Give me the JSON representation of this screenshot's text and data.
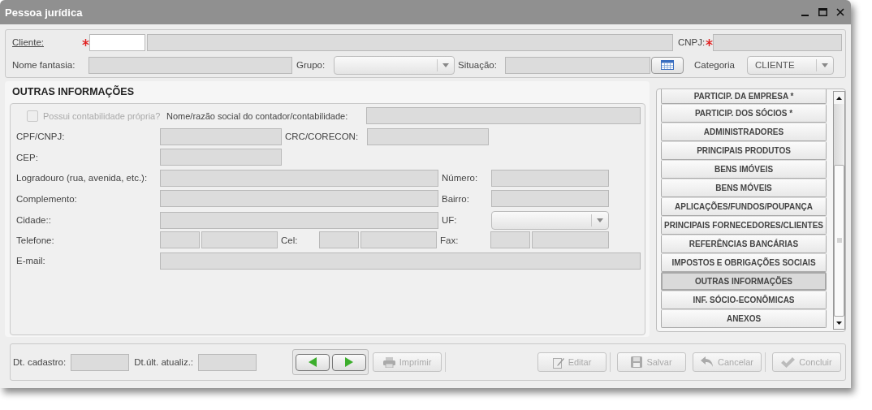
{
  "window": {
    "title": "Pessoa jurídica"
  },
  "header": {
    "cliente": {
      "label": "Cliente:",
      "required": true,
      "code_disabled": false,
      "name_disabled": true
    },
    "cnpj": {
      "label": "CNPJ:",
      "required": true,
      "disabled": true
    },
    "nome_fantasia": {
      "label": "Nome fantasia:",
      "disabled": true
    },
    "grupo": {
      "label": "Grupo:"
    },
    "situacao": {
      "label": "Situação:",
      "disabled": true
    },
    "categoria": {
      "label": "Categoria",
      "value": "CLIENTE"
    }
  },
  "section": {
    "title": "OUTRAS INFORMAÇÕES",
    "rows": [
      [
        {
          "kind": "checkbox",
          "label": "Possui contabilidade própria?",
          "checked": false,
          "disabled": true
        },
        {
          "kind": "label",
          "text": "Nome/razão social do contador/contabilidade:"
        },
        {
          "kind": "field",
          "disabled": true
        }
      ],
      [
        {
          "kind": "label",
          "text": "CPF/CNPJ:"
        },
        {
          "kind": "field",
          "disabled": true
        },
        {
          "kind": "label",
          "text": "CRC/CORECON:"
        },
        {
          "kind": "field",
          "disabled": true
        }
      ],
      [
        {
          "kind": "label",
          "text": "CEP:"
        },
        {
          "kind": "field",
          "disabled": true
        }
      ],
      [
        {
          "kind": "label",
          "text": "Logradouro (rua, avenida, etc.):"
        },
        {
          "kind": "field",
          "disabled": true
        },
        {
          "kind": "label",
          "text": "Número:"
        },
        {
          "kind": "field",
          "disabled": true
        }
      ],
      [
        {
          "kind": "label",
          "text": "Complemento:"
        },
        {
          "kind": "field",
          "disabled": true
        },
        {
          "kind": "label",
          "text": "Bairro:"
        },
        {
          "kind": "field",
          "disabled": true
        }
      ],
      [
        {
          "kind": "label",
          "text": "Cidade::"
        },
        {
          "kind": "field",
          "disabled": true
        },
        {
          "kind": "label",
          "text": "UF:"
        },
        {
          "kind": "select"
        }
      ],
      [
        {
          "kind": "label",
          "text": "Telefone:"
        },
        {
          "kind": "phone",
          "disabled": true
        },
        {
          "kind": "label",
          "text": "Cel:"
        },
        {
          "kind": "phone",
          "disabled": true
        },
        {
          "kind": "label",
          "text": "Fax:"
        },
        {
          "kind": "phone",
          "disabled": true
        }
      ],
      [
        {
          "kind": "label",
          "text": "E-mail:"
        },
        {
          "kind": "field",
          "disabled": true
        }
      ]
    ]
  },
  "side_list": [
    {
      "label": "PARTICIP. DA EMPRESA *",
      "selected": false
    },
    {
      "label": "PARTICIP. DOS SÓCIOS *",
      "selected": false
    },
    {
      "label": "ADMINISTRADORES",
      "selected": false
    },
    {
      "label": "PRINCIPAIS PRODUTOS",
      "selected": false
    },
    {
      "label": "BENS IMÓVEIS",
      "selected": false
    },
    {
      "label": "BENS MÓVEIS",
      "selected": false
    },
    {
      "label": "APLICAÇÕES/FUNDOS/POUPANÇA",
      "selected": false
    },
    {
      "label": "PRINCIPAIS FORNECEDORES/CLIENTES",
      "selected": false
    },
    {
      "label": "REFERÊNCIAS BANCÁRIAS",
      "selected": false
    },
    {
      "label": "IMPOSTOS E OBRIGAÇÕES SOCIAIS",
      "selected": false
    },
    {
      "label": "OUTRAS INFORMAÇÕES",
      "selected": true
    },
    {
      "label": "INF. SÓCIO-ECONÔMICAS",
      "selected": false
    },
    {
      "label": "ANEXOS",
      "selected": false
    }
  ],
  "footer": {
    "dt_cadastro": {
      "label": "Dt. cadastro:",
      "disabled": true
    },
    "dt_atualiz": {
      "label": "Dt.últ. atualiz.:",
      "disabled": true
    },
    "print_button": {
      "label": "Imprimir",
      "disabled": true
    },
    "actions": [
      {
        "label": "Editar",
        "disabled": true
      },
      {
        "label": "Salvar",
        "disabled": true
      },
      {
        "label": "Cancelar",
        "disabled": true
      },
      {
        "label": "Concluir",
        "disabled": true
      }
    ]
  }
}
